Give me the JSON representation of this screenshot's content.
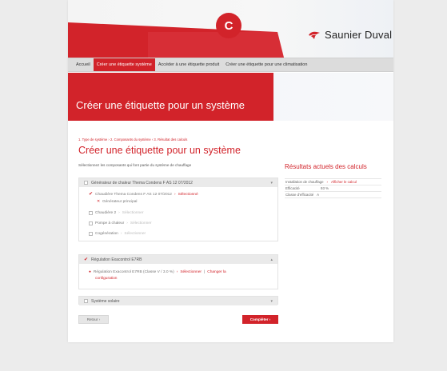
{
  "badge": "C",
  "brand": {
    "name": "Saunier Duval"
  },
  "nav": {
    "items": [
      {
        "label": "Accueil"
      },
      {
        "label": "Créer une étiquette système",
        "active": true
      },
      {
        "label": "Accéder à une étiquette produit"
      },
      {
        "label": "Créer une étiquette pour une climatisation"
      }
    ]
  },
  "hero": {
    "title": "Créer une étiquette pour un système"
  },
  "breadcrumb": "1. Type de système  ›  2. Composants du système  ›  3. Résultat des calculs",
  "main": {
    "title": "Créer une étiquette pour un système",
    "intro": "Sélectionnez les composants qui font partie du système de chauffage"
  },
  "panels": {
    "generator": {
      "header": "Générateur de chaleur  Thema Condens F AS 12 07/2012",
      "boiler_label": "Chaudière  Thema Condens F AS 12 07/2012",
      "boiler_action": "Sélectionné",
      "principal_label": "Générateur principal",
      "boiler2_label": "Chaudière 2",
      "boiler2_action": "Sélectionner",
      "heatpump_label": "Pompe à chaleur",
      "heatpump_action": "Sélectionner",
      "cogen_label": "Cogénération",
      "cogen_action": "Sélectionner"
    },
    "regulation": {
      "header": "Régulation  Exacontrol E7RB",
      "item_label": "Régulation  Exacontrol E7RB  (Classe V / 3.0 %)",
      "item_action1": "Sélectionner",
      "item_sep": "|",
      "item_action2": "Changer la",
      "item_action2b": "configuration"
    },
    "solar": {
      "header": "Système solaire"
    }
  },
  "results": {
    "title": "Résultats actuels des calculs",
    "rows": [
      {
        "label": "Installation de chauffage",
        "link": "Afficher le calcul"
      },
      {
        "label": "Efficacité",
        "value": "93 %"
      },
      {
        "label": "Classe d'efficacité",
        "value": "A"
      }
    ]
  },
  "buttons": {
    "back": "Retour  ›",
    "complete": "Compléter  ›"
  },
  "colors": {
    "brand_red": "#d2232a",
    "nav_bg": "#dcdcdc"
  }
}
